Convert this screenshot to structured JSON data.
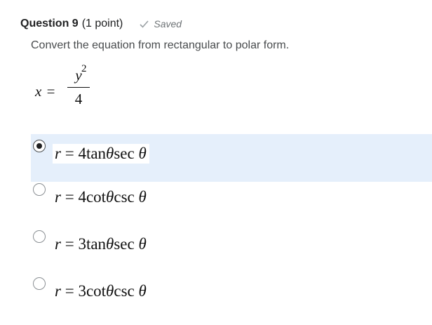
{
  "question": {
    "number_label": "Question 9",
    "points_label": "(1 point)",
    "status_label": "Saved",
    "prompt": "Convert the equation from rectangular to polar form."
  },
  "equation": {
    "lhs": "x",
    "equals": "=",
    "numerator": "y",
    "exponent": "2",
    "denominator": "4"
  },
  "options": [
    {
      "var": "r",
      "eq": "=",
      "coef": "4",
      "f1": "tan",
      "a1": "θ",
      "f2": "sec",
      "a2": "θ",
      "selected": true
    },
    {
      "var": "r",
      "eq": "=",
      "coef": "4",
      "f1": "cot",
      "a1": "θ",
      "f2": "csc",
      "a2": "θ",
      "selected": false
    },
    {
      "var": "r",
      "eq": "=",
      "coef": "3",
      "f1": "tan",
      "a1": "θ",
      "f2": "sec",
      "a2": "θ",
      "selected": false
    },
    {
      "var": "r",
      "eq": "=",
      "coef": "3",
      "f1": "cot",
      "a1": "θ",
      "f2": "csc",
      "a2": "θ",
      "selected": false
    }
  ],
  "colors": {
    "selected_background": "#e5effb",
    "text": "#494c4e",
    "status_text": "#6e7376"
  }
}
